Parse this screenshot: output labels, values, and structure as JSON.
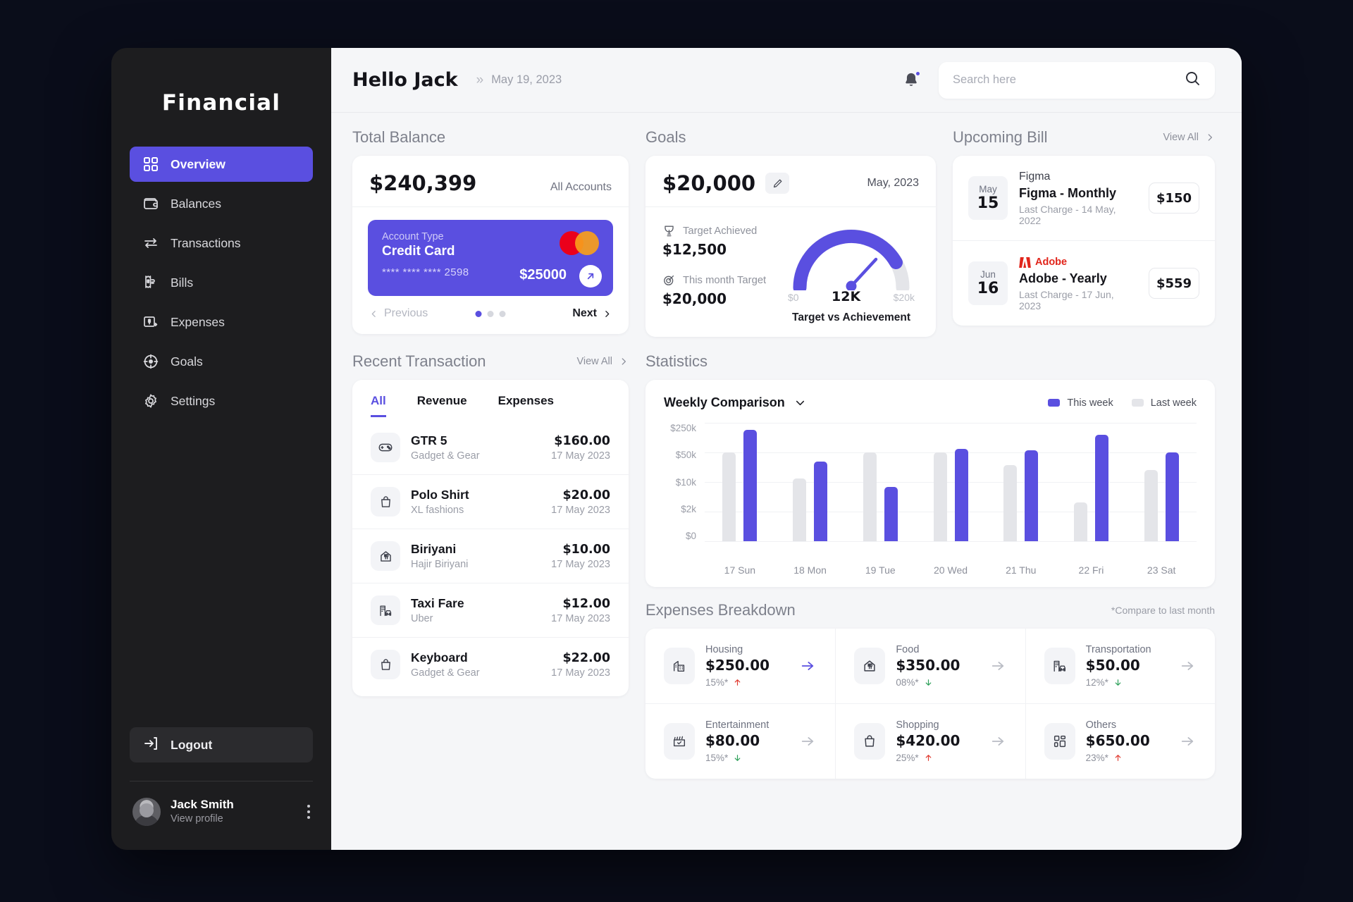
{
  "brand": "Financial",
  "sidebar": {
    "items": [
      {
        "label": "Overview",
        "icon": "grid-icon",
        "active": true
      },
      {
        "label": "Balances",
        "icon": "wallet-icon",
        "active": false
      },
      {
        "label": "Transactions",
        "icon": "transfer-icon",
        "active": false
      },
      {
        "label": "Bills",
        "icon": "bill-icon",
        "active": false
      },
      {
        "label": "Expenses",
        "icon": "expense-icon",
        "active": false
      },
      {
        "label": "Goals",
        "icon": "target-icon",
        "active": false
      },
      {
        "label": "Settings",
        "icon": "gear-icon",
        "active": false
      }
    ],
    "logout": "Logout",
    "profile": {
      "name": "Jack Smith",
      "subtitle": "View profile"
    }
  },
  "topbar": {
    "greeting": "Hello Jack",
    "date": "May 19, 2023",
    "search_placeholder": "Search here",
    "search_value": ""
  },
  "total_balance": {
    "title": "Total Balance",
    "amount": "$240,399",
    "accounts_label": "All Accounts",
    "card": {
      "type_label": "Account Type",
      "type": "Credit Card",
      "number": "**** **** **** 2598",
      "balance": "$25000"
    },
    "prev": "Previous",
    "next": "Next",
    "active_dot": 0,
    "dot_count": 3
  },
  "goals": {
    "title": "Goals",
    "amount": "$20,000",
    "date": "May, 2023",
    "target_achieved_label": "Target Achieved",
    "target_achieved": "$12,500",
    "this_month_label": "This month Target",
    "this_month": "$20,000",
    "gauge": {
      "min": "$0",
      "value": "12K",
      "max": "$20k",
      "caption": "Target vs Achievement",
      "percent": 62
    }
  },
  "upcoming_bill": {
    "title": "Upcoming Bill",
    "view_all": "View All",
    "items": [
      {
        "month": "May",
        "day": "15",
        "logo": "Figma",
        "logo_kind": "figma",
        "name": "Figma - Monthly",
        "last_charge": "Last Charge - 14 May, 2022",
        "price": "$150"
      },
      {
        "month": "Jun",
        "day": "16",
        "logo": "Adobe",
        "logo_kind": "adobe",
        "name": "Adobe - Yearly",
        "last_charge": "Last Charge - 17 Jun, 2023",
        "price": "$559"
      }
    ]
  },
  "recent_transaction": {
    "title": "Recent Transaction",
    "view_all": "View All",
    "tabs": [
      {
        "label": "All",
        "active": true
      },
      {
        "label": "Revenue",
        "active": false
      },
      {
        "label": "Expenses",
        "active": false
      }
    ],
    "rows": [
      {
        "name": "GTR 5",
        "merchant": "Gadget & Gear",
        "amount": "$160.00",
        "date": "17 May 2023",
        "icon": "gamepad-icon"
      },
      {
        "name": "Polo Shirt",
        "merchant": "XL fashions",
        "amount": "$20.00",
        "date": "17 May 2023",
        "icon": "bag-icon"
      },
      {
        "name": "Biriyani",
        "merchant": "Hajir Biriyani",
        "amount": "$10.00",
        "date": "17 May 2023",
        "icon": "restaurant-icon"
      },
      {
        "name": "Taxi Fare",
        "merchant": "Uber",
        "amount": "$12.00",
        "date": "17 May 2023",
        "icon": "taxi-icon"
      },
      {
        "name": "Keyboard",
        "merchant": "Gadget & Gear",
        "amount": "$22.00",
        "date": "17 May 2023",
        "icon": "bag-icon"
      }
    ]
  },
  "statistics": {
    "title": "Statistics",
    "dropdown": "Weekly Comparison",
    "legend": [
      {
        "label": "This week",
        "color": "#5a4fe0"
      },
      {
        "label": "Last week",
        "color": "#e4e5e9"
      }
    ]
  },
  "chart_data": {
    "type": "bar",
    "title": "Weekly Comparison",
    "xlabel": "",
    "ylabel": "",
    "categories": [
      "17 Sun",
      "18 Mon",
      "19 Tue",
      "20 Wed",
      "21 Thu",
      "22 Fri",
      "23 Sat"
    ],
    "ytick_labels": [
      "$250k",
      "$50k",
      "$10k",
      "$2k",
      "$0"
    ],
    "ytick_fractions": [
      1.0,
      0.75,
      0.5,
      0.25,
      0.0
    ],
    "grid": true,
    "legend_position": "top-right",
    "series": [
      {
        "name": "Last week",
        "color": "#e4e5e9",
        "values": [
          50000,
          12000,
          50000,
          50000,
          25000,
          4000,
          20000
        ],
        "bar_fractions": [
          0.75,
          0.53,
          0.75,
          0.75,
          0.64,
          0.33,
          0.6
        ]
      },
      {
        "name": "This week",
        "color": "#5a4fe0",
        "values": [
          200000,
          30000,
          8000,
          60000,
          55000,
          150000,
          50000
        ],
        "bar_fractions": [
          0.94,
          0.67,
          0.46,
          0.78,
          0.77,
          0.9,
          0.75
        ]
      }
    ]
  },
  "expenses_breakdown": {
    "title": "Expenses Breakdown",
    "note": "*Compare to last month",
    "items": [
      {
        "label": "Housing",
        "amount": "$250.00",
        "pct": "15%*",
        "direction": "up",
        "icon": "building-icon",
        "arrow_accent": true
      },
      {
        "label": "Food",
        "amount": "$350.00",
        "pct": "08%*",
        "direction": "down",
        "icon": "restaurant-icon",
        "arrow_accent": false
      },
      {
        "label": "Transportation",
        "amount": "$50.00",
        "pct": "12%*",
        "direction": "down",
        "icon": "taxi-icon",
        "arrow_accent": false
      },
      {
        "label": "Entertainment",
        "amount": "$80.00",
        "pct": "15%*",
        "direction": "down",
        "icon": "clapper-icon",
        "arrow_accent": false
      },
      {
        "label": "Shopping",
        "amount": "$420.00",
        "pct": "25%*",
        "direction": "up",
        "icon": "bag-icon",
        "arrow_accent": false
      },
      {
        "label": "Others",
        "amount": "$650.00",
        "pct": "23%*",
        "direction": "up",
        "icon": "grid-icon",
        "arrow_accent": false
      }
    ]
  },
  "colors": {
    "accent": "#5a4fe0",
    "background": "#0a0d1a",
    "sidebar": "#1d1d1f",
    "surface": "#f5f6f8",
    "up": "#e03a2f",
    "down": "#2ea05a",
    "mastercard_red": "#eb001b",
    "mastercard_orange": "#f79e1b"
  }
}
